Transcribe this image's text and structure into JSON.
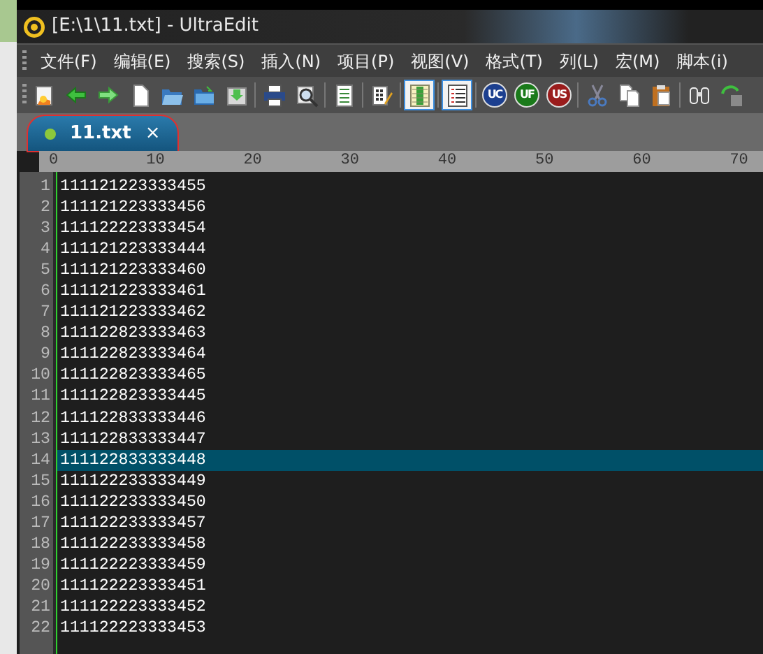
{
  "window": {
    "title": "[E:\\1\\11.txt] - UltraEdit"
  },
  "menu": [
    "文件(F)",
    "编辑(E)",
    "搜索(S)",
    "插入(N)",
    "项目(P)",
    "视图(V)",
    "格式(T)",
    "列(L)",
    "宏(M)",
    "脚本(i)"
  ],
  "toolbar": [
    {
      "kind": "script",
      "pressed": false
    },
    {
      "kind": "back",
      "pressed": false
    },
    {
      "kind": "forward",
      "pressed": false
    },
    {
      "kind": "new",
      "pressed": false
    },
    {
      "kind": "open",
      "pressed": false
    },
    {
      "kind": "folder",
      "pressed": false
    },
    {
      "kind": "save",
      "pressed": false
    },
    {
      "kind": "separator"
    },
    {
      "kind": "print",
      "pressed": false
    },
    {
      "kind": "preview",
      "pressed": false
    },
    {
      "kind": "separator"
    },
    {
      "kind": "list",
      "pressed": false
    },
    {
      "kind": "separator"
    },
    {
      "kind": "hex",
      "pressed": false
    },
    {
      "kind": "separator"
    },
    {
      "kind": "column",
      "pressed": true
    },
    {
      "kind": "separator"
    },
    {
      "kind": "lines",
      "pressed": true
    },
    {
      "kind": "separator"
    },
    {
      "kind": "badge",
      "label": "UC",
      "color": "#1c3f8f",
      "pressed": false
    },
    {
      "kind": "badge",
      "label": "UF",
      "color": "#1a7a1a",
      "pressed": false
    },
    {
      "kind": "badge",
      "label": "US",
      "color": "#9a1c1c",
      "pressed": false
    },
    {
      "kind": "separator"
    },
    {
      "kind": "cut",
      "pressed": false
    },
    {
      "kind": "copy",
      "pressed": false
    },
    {
      "kind": "paste",
      "pressed": false
    },
    {
      "kind": "separator"
    },
    {
      "kind": "find",
      "pressed": false
    },
    {
      "kind": "replace",
      "pressed": false
    }
  ],
  "tabs": [
    {
      "label": "11.txt",
      "close": "×",
      "selected": true,
      "highlighted": true
    }
  ],
  "ruler": [
    "0",
    "10",
    "20",
    "30",
    "40",
    "50",
    "60",
    "70"
  ],
  "lines": [
    {
      "number": "1",
      "text": "111121223333455",
      "selected": false
    },
    {
      "number": "2",
      "text": "111121223333456",
      "selected": false
    },
    {
      "number": "3",
      "text": "111122223333454",
      "selected": false
    },
    {
      "number": "4",
      "text": "111121223333444",
      "selected": false
    },
    {
      "number": "5",
      "text": "111121223333460",
      "selected": false
    },
    {
      "number": "6",
      "text": "111121223333461",
      "selected": false
    },
    {
      "number": "7",
      "text": "111121223333462",
      "selected": false
    },
    {
      "number": "8",
      "text": "111122823333463",
      "selected": false
    },
    {
      "number": "9",
      "text": "111122823333464",
      "selected": false
    },
    {
      "number": "10",
      "text": "111122823333465",
      "selected": false
    },
    {
      "number": "11",
      "text": "111122823333445",
      "selected": false
    },
    {
      "number": "12",
      "text": "111122833333446",
      "selected": false
    },
    {
      "number": "13",
      "text": "111122833333447",
      "selected": false
    },
    {
      "number": "14",
      "text": "111122833333448",
      "selected": true
    },
    {
      "number": "15",
      "text": "111122233333449",
      "selected": false
    },
    {
      "number": "16",
      "text": "111122233333450",
      "selected": false
    },
    {
      "number": "17",
      "text": "111122233333457",
      "selected": false
    },
    {
      "number": "18",
      "text": "111122233333458",
      "selected": false
    },
    {
      "number": "19",
      "text": "111122223333459",
      "selected": false
    },
    {
      "number": "20",
      "text": "111122223333451",
      "selected": false
    },
    {
      "number": "21",
      "text": "111122223333452",
      "selected": false
    },
    {
      "number": "22",
      "text": "111122223333453",
      "selected": false
    }
  ]
}
